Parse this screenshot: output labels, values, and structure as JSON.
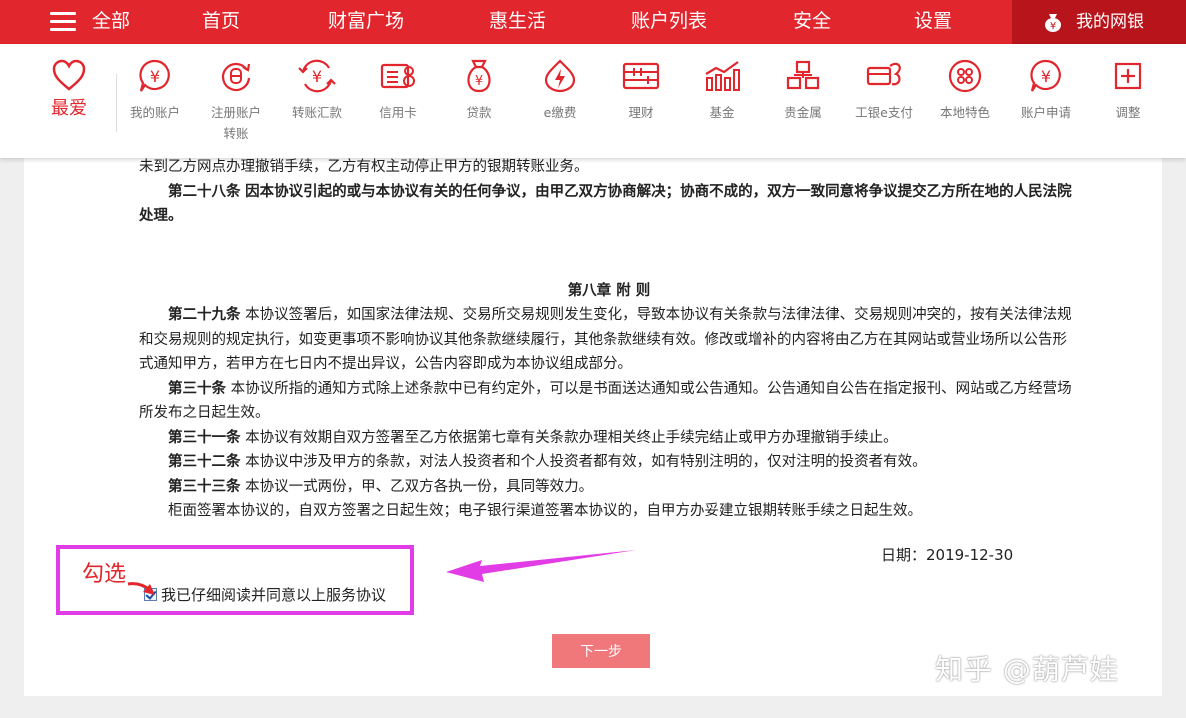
{
  "nav": {
    "menu_label": "全部",
    "items": [
      "首页",
      "财富广场",
      "惠生活",
      "账户列表",
      "安全",
      "设置"
    ],
    "my_bank": "我的网银"
  },
  "toolbar": {
    "favorites": "最爱",
    "items": [
      "我的账户",
      "注册账户转账",
      "转账汇款",
      "信用卡",
      "贷款",
      "e缴费",
      "理财",
      "基金",
      "贵金属",
      "工银e支付",
      "本地特色",
      "账户申请",
      "调整"
    ]
  },
  "doc": {
    "p1": "未到乙方网点办理撤销手续，乙方有权主动停止甲方的银期转账业务。",
    "a28_title": "第二十八条",
    "a28_text": "因本协议引起的或与本协议有关的任何争议，由甲乙双方协商解决；协商不成的，双方一致同意将争议提交乙方所在地的人民法院处理。",
    "chapter": "第八章 附 则",
    "a29_title": "第二十九条",
    "a29_text": "本协议签署后，如国家法律法规、交易所交易规则发生变化，导致本协议有关条款与法律法律、交易规则冲突的，按有关法律法规和交易规则的规定执行，如变更事项不影响协议其他条款继续履行，其他条款继续有效。修改或增补的内容将由乙方在其网站或营业场所以公告形式通知甲方，若甲方在七日内不提出异议，公告内容即成为本协议组成部分。",
    "a30_title": "第三十条",
    "a30_text": "本协议所指的通知方式除上述条款中已有约定外，可以是书面送达通知或公告通知。公告通知自公告在指定报刊、网站或乙方经营场所发布之日起生效。",
    "a31_title": "第三十一条",
    "a31_text": "本协议有效期自双方签署至乙方依据第七章有关条款办理相关终止手续完结止或甲方办理撤销手续止。",
    "a32_title": "第三十二条",
    "a32_text": "本协议中涉及甲方的条款，对法人投资者和个人投资者都有效，如有特别注明的，仅对注明的投资者有效。",
    "a33_title": "第三十三条",
    "a33_text": "本协议一式两份，甲、乙双方各执一份，具同等效力。",
    "closing": "柜面签署本协议的，自双方签署之日起生效；电子银行渠道签署本协议的，自甲方办妥建立银期转账手续之日起生效。",
    "date": "日期：2019-12-30"
  },
  "agree_label": "我已仔细阅读并同意以上服务协议",
  "annotation": "勾选",
  "next_button": "下一步",
  "watermark": "知乎 @葫芦娃",
  "colors": {
    "brand_red": "#e1262d",
    "dark_red": "#b7141b",
    "annotation_magenta": "#e23ce6",
    "button_pink": "#f0787b"
  }
}
